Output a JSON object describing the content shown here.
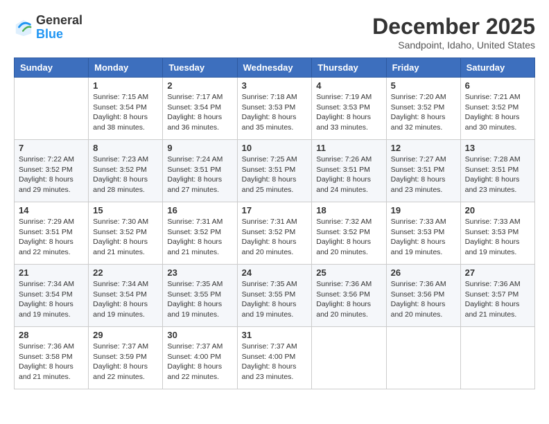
{
  "header": {
    "logo_general": "General",
    "logo_blue": "Blue",
    "month": "December 2025",
    "location": "Sandpoint, Idaho, United States"
  },
  "weekdays": [
    "Sunday",
    "Monday",
    "Tuesday",
    "Wednesday",
    "Thursday",
    "Friday",
    "Saturday"
  ],
  "weeks": [
    [
      {
        "day": "",
        "info": ""
      },
      {
        "day": "1",
        "info": "Sunrise: 7:15 AM\nSunset: 3:54 PM\nDaylight: 8 hours\nand 38 minutes."
      },
      {
        "day": "2",
        "info": "Sunrise: 7:17 AM\nSunset: 3:54 PM\nDaylight: 8 hours\nand 36 minutes."
      },
      {
        "day": "3",
        "info": "Sunrise: 7:18 AM\nSunset: 3:53 PM\nDaylight: 8 hours\nand 35 minutes."
      },
      {
        "day": "4",
        "info": "Sunrise: 7:19 AM\nSunset: 3:53 PM\nDaylight: 8 hours\nand 33 minutes."
      },
      {
        "day": "5",
        "info": "Sunrise: 7:20 AM\nSunset: 3:52 PM\nDaylight: 8 hours\nand 32 minutes."
      },
      {
        "day": "6",
        "info": "Sunrise: 7:21 AM\nSunset: 3:52 PM\nDaylight: 8 hours\nand 30 minutes."
      }
    ],
    [
      {
        "day": "7",
        "info": "Sunrise: 7:22 AM\nSunset: 3:52 PM\nDaylight: 8 hours\nand 29 minutes."
      },
      {
        "day": "8",
        "info": "Sunrise: 7:23 AM\nSunset: 3:52 PM\nDaylight: 8 hours\nand 28 minutes."
      },
      {
        "day": "9",
        "info": "Sunrise: 7:24 AM\nSunset: 3:51 PM\nDaylight: 8 hours\nand 27 minutes."
      },
      {
        "day": "10",
        "info": "Sunrise: 7:25 AM\nSunset: 3:51 PM\nDaylight: 8 hours\nand 25 minutes."
      },
      {
        "day": "11",
        "info": "Sunrise: 7:26 AM\nSunset: 3:51 PM\nDaylight: 8 hours\nand 24 minutes."
      },
      {
        "day": "12",
        "info": "Sunrise: 7:27 AM\nSunset: 3:51 PM\nDaylight: 8 hours\nand 23 minutes."
      },
      {
        "day": "13",
        "info": "Sunrise: 7:28 AM\nSunset: 3:51 PM\nDaylight: 8 hours\nand 23 minutes."
      }
    ],
    [
      {
        "day": "14",
        "info": "Sunrise: 7:29 AM\nSunset: 3:51 PM\nDaylight: 8 hours\nand 22 minutes."
      },
      {
        "day": "15",
        "info": "Sunrise: 7:30 AM\nSunset: 3:52 PM\nDaylight: 8 hours\nand 21 minutes."
      },
      {
        "day": "16",
        "info": "Sunrise: 7:31 AM\nSunset: 3:52 PM\nDaylight: 8 hours\nand 21 minutes."
      },
      {
        "day": "17",
        "info": "Sunrise: 7:31 AM\nSunset: 3:52 PM\nDaylight: 8 hours\nand 20 minutes."
      },
      {
        "day": "18",
        "info": "Sunrise: 7:32 AM\nSunset: 3:52 PM\nDaylight: 8 hours\nand 20 minutes."
      },
      {
        "day": "19",
        "info": "Sunrise: 7:33 AM\nSunset: 3:53 PM\nDaylight: 8 hours\nand 19 minutes."
      },
      {
        "day": "20",
        "info": "Sunrise: 7:33 AM\nSunset: 3:53 PM\nDaylight: 8 hours\nand 19 minutes."
      }
    ],
    [
      {
        "day": "21",
        "info": "Sunrise: 7:34 AM\nSunset: 3:54 PM\nDaylight: 8 hours\nand 19 minutes."
      },
      {
        "day": "22",
        "info": "Sunrise: 7:34 AM\nSunset: 3:54 PM\nDaylight: 8 hours\nand 19 minutes."
      },
      {
        "day": "23",
        "info": "Sunrise: 7:35 AM\nSunset: 3:55 PM\nDaylight: 8 hours\nand 19 minutes."
      },
      {
        "day": "24",
        "info": "Sunrise: 7:35 AM\nSunset: 3:55 PM\nDaylight: 8 hours\nand 19 minutes."
      },
      {
        "day": "25",
        "info": "Sunrise: 7:36 AM\nSunset: 3:56 PM\nDaylight: 8 hours\nand 20 minutes."
      },
      {
        "day": "26",
        "info": "Sunrise: 7:36 AM\nSunset: 3:56 PM\nDaylight: 8 hours\nand 20 minutes."
      },
      {
        "day": "27",
        "info": "Sunrise: 7:36 AM\nSunset: 3:57 PM\nDaylight: 8 hours\nand 21 minutes."
      }
    ],
    [
      {
        "day": "28",
        "info": "Sunrise: 7:36 AM\nSunset: 3:58 PM\nDaylight: 8 hours\nand 21 minutes."
      },
      {
        "day": "29",
        "info": "Sunrise: 7:37 AM\nSunset: 3:59 PM\nDaylight: 8 hours\nand 22 minutes."
      },
      {
        "day": "30",
        "info": "Sunrise: 7:37 AM\nSunset: 4:00 PM\nDaylight: 8 hours\nand 22 minutes."
      },
      {
        "day": "31",
        "info": "Sunrise: 7:37 AM\nSunset: 4:00 PM\nDaylight: 8 hours\nand 23 minutes."
      },
      {
        "day": "",
        "info": ""
      },
      {
        "day": "",
        "info": ""
      },
      {
        "day": "",
        "info": ""
      }
    ]
  ]
}
